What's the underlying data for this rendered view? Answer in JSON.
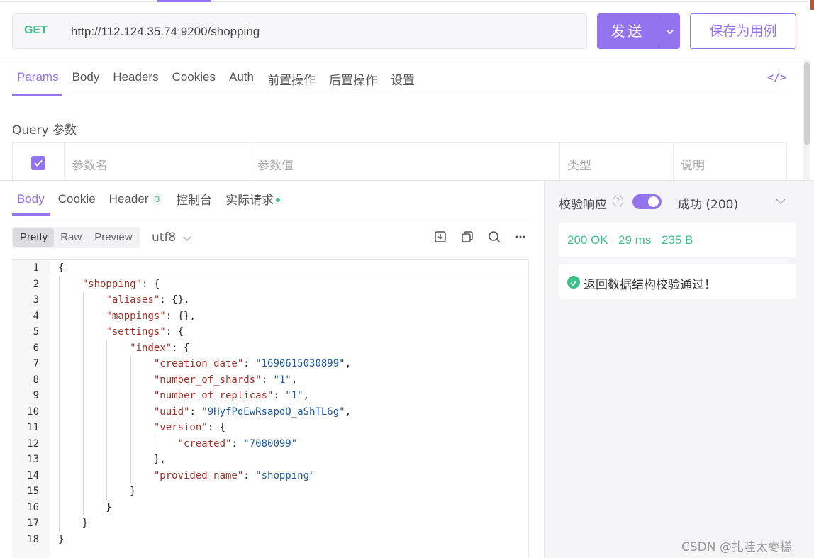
{
  "request": {
    "method": "GET",
    "url": "http://112.124.35.74:9200/shopping",
    "send_label": "发送",
    "save_label": "保存为用例"
  },
  "request_tabs": [
    "Params",
    "Body",
    "Headers",
    "Cookies",
    "Auth",
    "前置操作",
    "后置操作",
    "设置"
  ],
  "request_tab_active": "Params",
  "query": {
    "title": "Query 参数",
    "columns": [
      "参数名",
      "参数值",
      "类型",
      "说明"
    ]
  },
  "response_tabs": {
    "body": "Body",
    "cookie": "Cookie",
    "header": "Header",
    "header_count": "3",
    "console": "控制台",
    "actual": "实际请求"
  },
  "view_modes": [
    "Pretty",
    "Raw",
    "Preview"
  ],
  "view_mode_active": "Pretty",
  "encoding": "utf8",
  "code_lines": [
    "{",
    "    \"shopping\": {",
    "        \"aliases\": {},",
    "        \"mappings\": {},",
    "        \"settings\": {",
    "            \"index\": {",
    "                \"creation_date\": \"1690615030899\",",
    "                \"number_of_shards\": \"1\",",
    "                \"number_of_replicas\": \"1\",",
    "                \"uuid\": \"9HyfPqEwRsapdQ_aShTL6g\",",
    "                \"version\": {",
    "                    \"created\": \"7080099\"",
    "                },",
    "                \"provided_name\": \"shopping\"",
    "            }",
    "        }",
    "    }",
    "}"
  ],
  "validation": {
    "label": "校验响应",
    "status": "成功 (200)",
    "enabled": true,
    "http_status": "200 OK",
    "time": "29 ms",
    "size": "235 B",
    "message": "返回数据结构校验通过！"
  },
  "watermark": "CSDN @扎哇太枣糕",
  "colors": {
    "accent": "#9373ee",
    "success": "#3fbf8a",
    "method_get": "#3fbf8a",
    "json_key": "#a0322a",
    "json_string": "#1d57a0"
  },
  "icons": {
    "code_view": "code-brackets-icon",
    "download": "download-icon",
    "copy": "copy-icon",
    "search": "search-icon",
    "more": "ellipsis-icon"
  }
}
